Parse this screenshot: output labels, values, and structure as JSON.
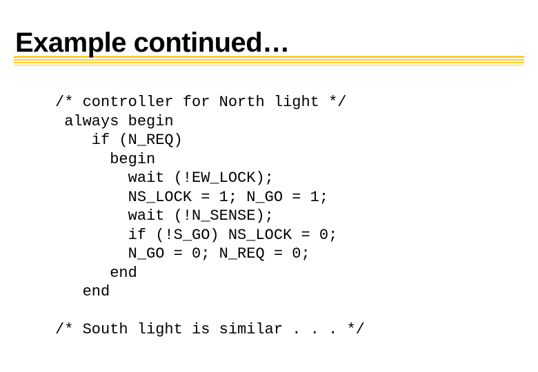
{
  "slide": {
    "title": "Example continued…",
    "code": "/* controller for North light */\n always begin\n    if (N_REQ)\n      begin\n        wait (!EW_LOCK);\n        NS_LOCK = 1; N_GO = 1;\n        wait (!N_SENSE);\n        if (!S_GO) NS_LOCK = 0;\n        N_GO = 0; N_REQ = 0;\n      end\n   end\n\n/* South light is similar . . . */"
  }
}
